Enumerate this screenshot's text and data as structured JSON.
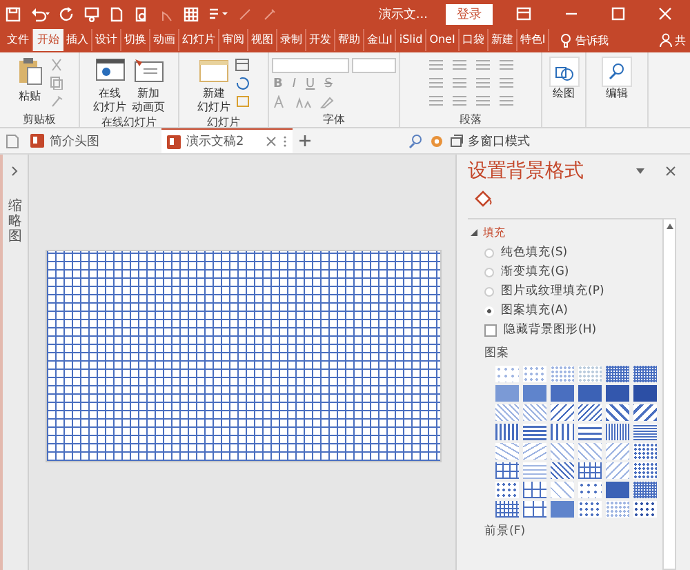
{
  "title_bar": {
    "doc_title": "演示文...",
    "login_button": "登录"
  },
  "ribbon_tabs": [
    {
      "label": "文件",
      "selected": false
    },
    {
      "label": "开始",
      "selected": true
    },
    {
      "label": "插入",
      "selected": false
    },
    {
      "label": "设计",
      "selected": false
    },
    {
      "label": "切换",
      "selected": false
    },
    {
      "label": "动画",
      "selected": false
    },
    {
      "label": "幻灯片",
      "selected": false
    },
    {
      "label": "审阅",
      "selected": false
    },
    {
      "label": "视图",
      "selected": false
    },
    {
      "label": "录制",
      "selected": false
    },
    {
      "label": "开发",
      "selected": false
    },
    {
      "label": "帮助",
      "selected": false
    },
    {
      "label": "金山I",
      "selected": false
    },
    {
      "label": "iSlid",
      "selected": false
    },
    {
      "label": "OneI",
      "selected": false
    },
    {
      "label": "口袋",
      "selected": false
    },
    {
      "label": "新建",
      "selected": false
    },
    {
      "label": "特色I",
      "selected": false
    }
  ],
  "tell_me": "告诉我",
  "share": "共",
  "ribbon_groups": [
    {
      "kind": "clipboard",
      "label": "剪贴板",
      "buttons": [
        "粘贴"
      ]
    },
    {
      "kind": "online",
      "label": "在线幻灯片",
      "buttons": [
        "在线幻灯片",
        "新加动画页"
      ]
    },
    {
      "kind": "slides",
      "label": "幻灯片",
      "buttons": [
        "新建幻灯片"
      ]
    },
    {
      "kind": "font",
      "label": "字体",
      "buttons": [
        "B",
        "I",
        "U",
        "S"
      ]
    },
    {
      "kind": "paragraph",
      "label": "段落"
    },
    {
      "kind": "drawing",
      "buttons": [
        "绘图"
      ]
    },
    {
      "kind": "editing",
      "buttons": [
        "编辑"
      ]
    }
  ],
  "doc_tabs": [
    {
      "label": "简介头图",
      "selected": false
    },
    {
      "label": "演示文稿2",
      "selected": true
    }
  ],
  "multi_window": "多窗口模式",
  "thumbnails_label": "缩略图",
  "panel": {
    "title": "设置背景格式",
    "section": "填充",
    "expanded": true,
    "options": [
      {
        "kind": "radio",
        "label": "纯色填充(S)",
        "selected": false
      },
      {
        "kind": "radio",
        "label": "渐变填充(G)",
        "selected": false
      },
      {
        "kind": "radio",
        "label": "图片或纹理填充(P)",
        "selected": false
      },
      {
        "kind": "radio",
        "label": "图案填充(A)",
        "selected": true
      },
      {
        "kind": "checkbox",
        "label": "隐藏背景图形(H)",
        "checked": false
      }
    ],
    "gallery_label": "图案",
    "foreground_label": "前景(F)"
  }
}
